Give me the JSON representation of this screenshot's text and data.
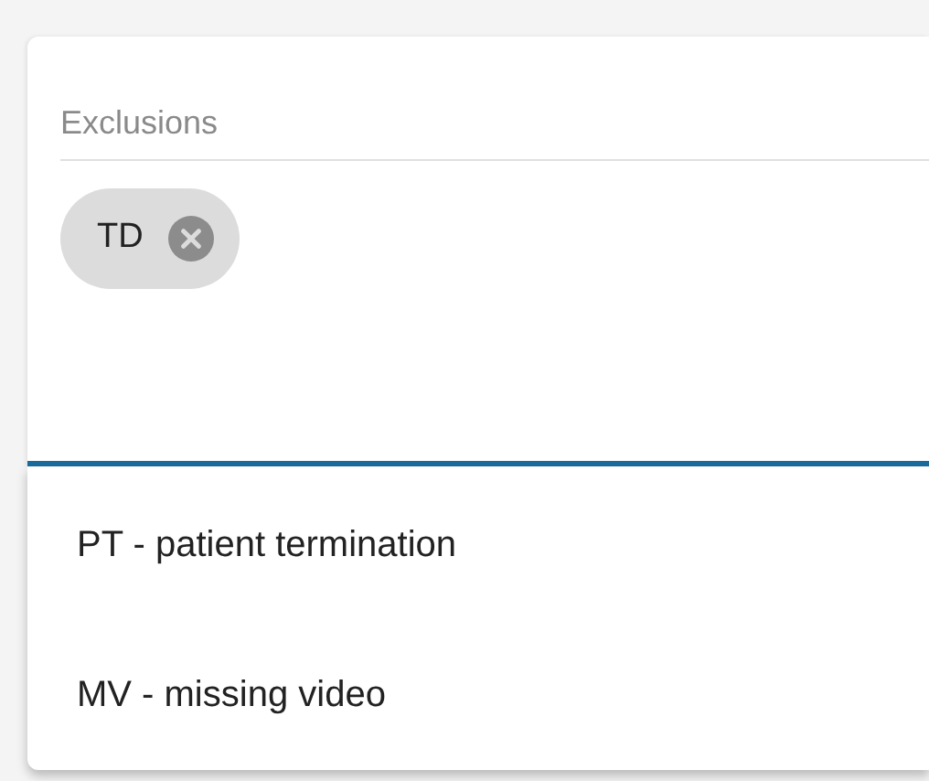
{
  "field": {
    "label": "Exclusions",
    "focused": true,
    "chips": [
      {
        "label": "TD"
      }
    ]
  },
  "menu": {
    "options": [
      {
        "label": "PT - patient termination"
      },
      {
        "label": "MV - missing video"
      }
    ]
  }
}
